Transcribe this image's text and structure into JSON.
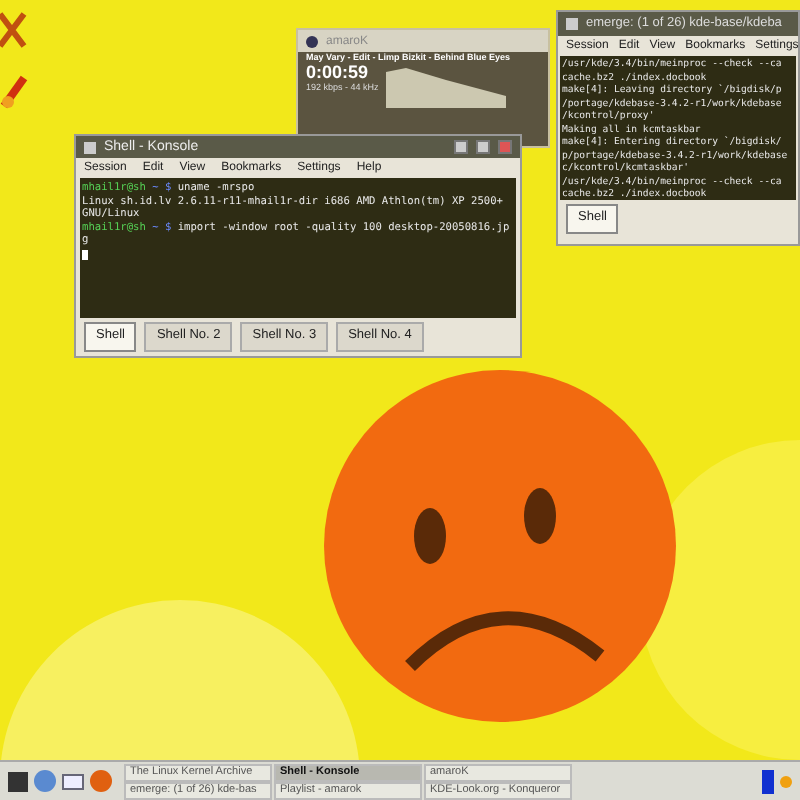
{
  "player": {
    "title": "amaroK",
    "track": "May Vary - Edit - Limp Bizkit - Behind Blue Eyes",
    "time": "0:00:59",
    "bitrate": "192 kbps - 44 kHz"
  },
  "konsole": {
    "title": "Shell - Konsole",
    "menu": [
      "Session",
      "Edit",
      "View",
      "Bookmarks",
      "Settings",
      "Help"
    ],
    "lines": [
      {
        "kind": "prompt",
        "user": "mhail1r@sh",
        "path": "~ $",
        "text": "uname -mrspo"
      },
      {
        "kind": "output",
        "text": "Linux sh.id.lv 2.6.11-r11-mhail1r-dir i686 AMD Athlon(tm) XP 2500+"
      },
      {
        "kind": "output",
        "text": "GNU/Linux"
      },
      {
        "kind": "prompt",
        "user": "mhail1r@sh",
        "path": "~ $",
        "text": "import -window root -quality 100 desktop-20050816.jp"
      },
      {
        "kind": "output",
        "text": "g"
      }
    ],
    "tabs": [
      {
        "label": "Shell",
        "selected": true
      },
      {
        "label": "Shell No. 2",
        "selected": false
      },
      {
        "label": "Shell No. 3",
        "selected": false
      },
      {
        "label": "Shell No. 4",
        "selected": false
      }
    ]
  },
  "emerge": {
    "title": "emerge: (1 of 26) kde-base/kdeba",
    "menu": [
      "Session",
      "Edit",
      "View",
      "Bookmarks",
      "Settings"
    ],
    "lines": [
      "/usr/kde/3.4/bin/meinproc --check --ca",
      "cache.bz2 ./index.docbook",
      "make[4]: Leaving directory `/bigdisk/p",
      "/portage/kdebase-3.4.2-r1/work/kdebase",
      "/kcontrol/proxy'",
      "Making all in kcmtaskbar",
      "make[4]: Entering directory `/bigdisk/",
      "p/portage/kdebase-3.4.2-r1/work/kdebase",
      "c/kcontrol/kcmtaskbar'",
      "/usr/kde/3.4/bin/meinproc --check --ca",
      "cache.bz2 ./index.docbook"
    ],
    "tabs": [
      {
        "label": "Shell",
        "selected": true
      }
    ]
  },
  "taskbar": {
    "tasks": [
      {
        "label": "The Linux Kernel Archive",
        "selected": false
      },
      {
        "label": "Shell - Konsole",
        "selected": true
      },
      {
        "label": "amaroK",
        "selected": false
      },
      {
        "label": "emerge: (1 of 26) kde-bas",
        "selected": false
      },
      {
        "label": "Playlist - amarok",
        "selected": false
      },
      {
        "label": "KDE-Look.org - Konqueror",
        "selected": false
      }
    ]
  }
}
